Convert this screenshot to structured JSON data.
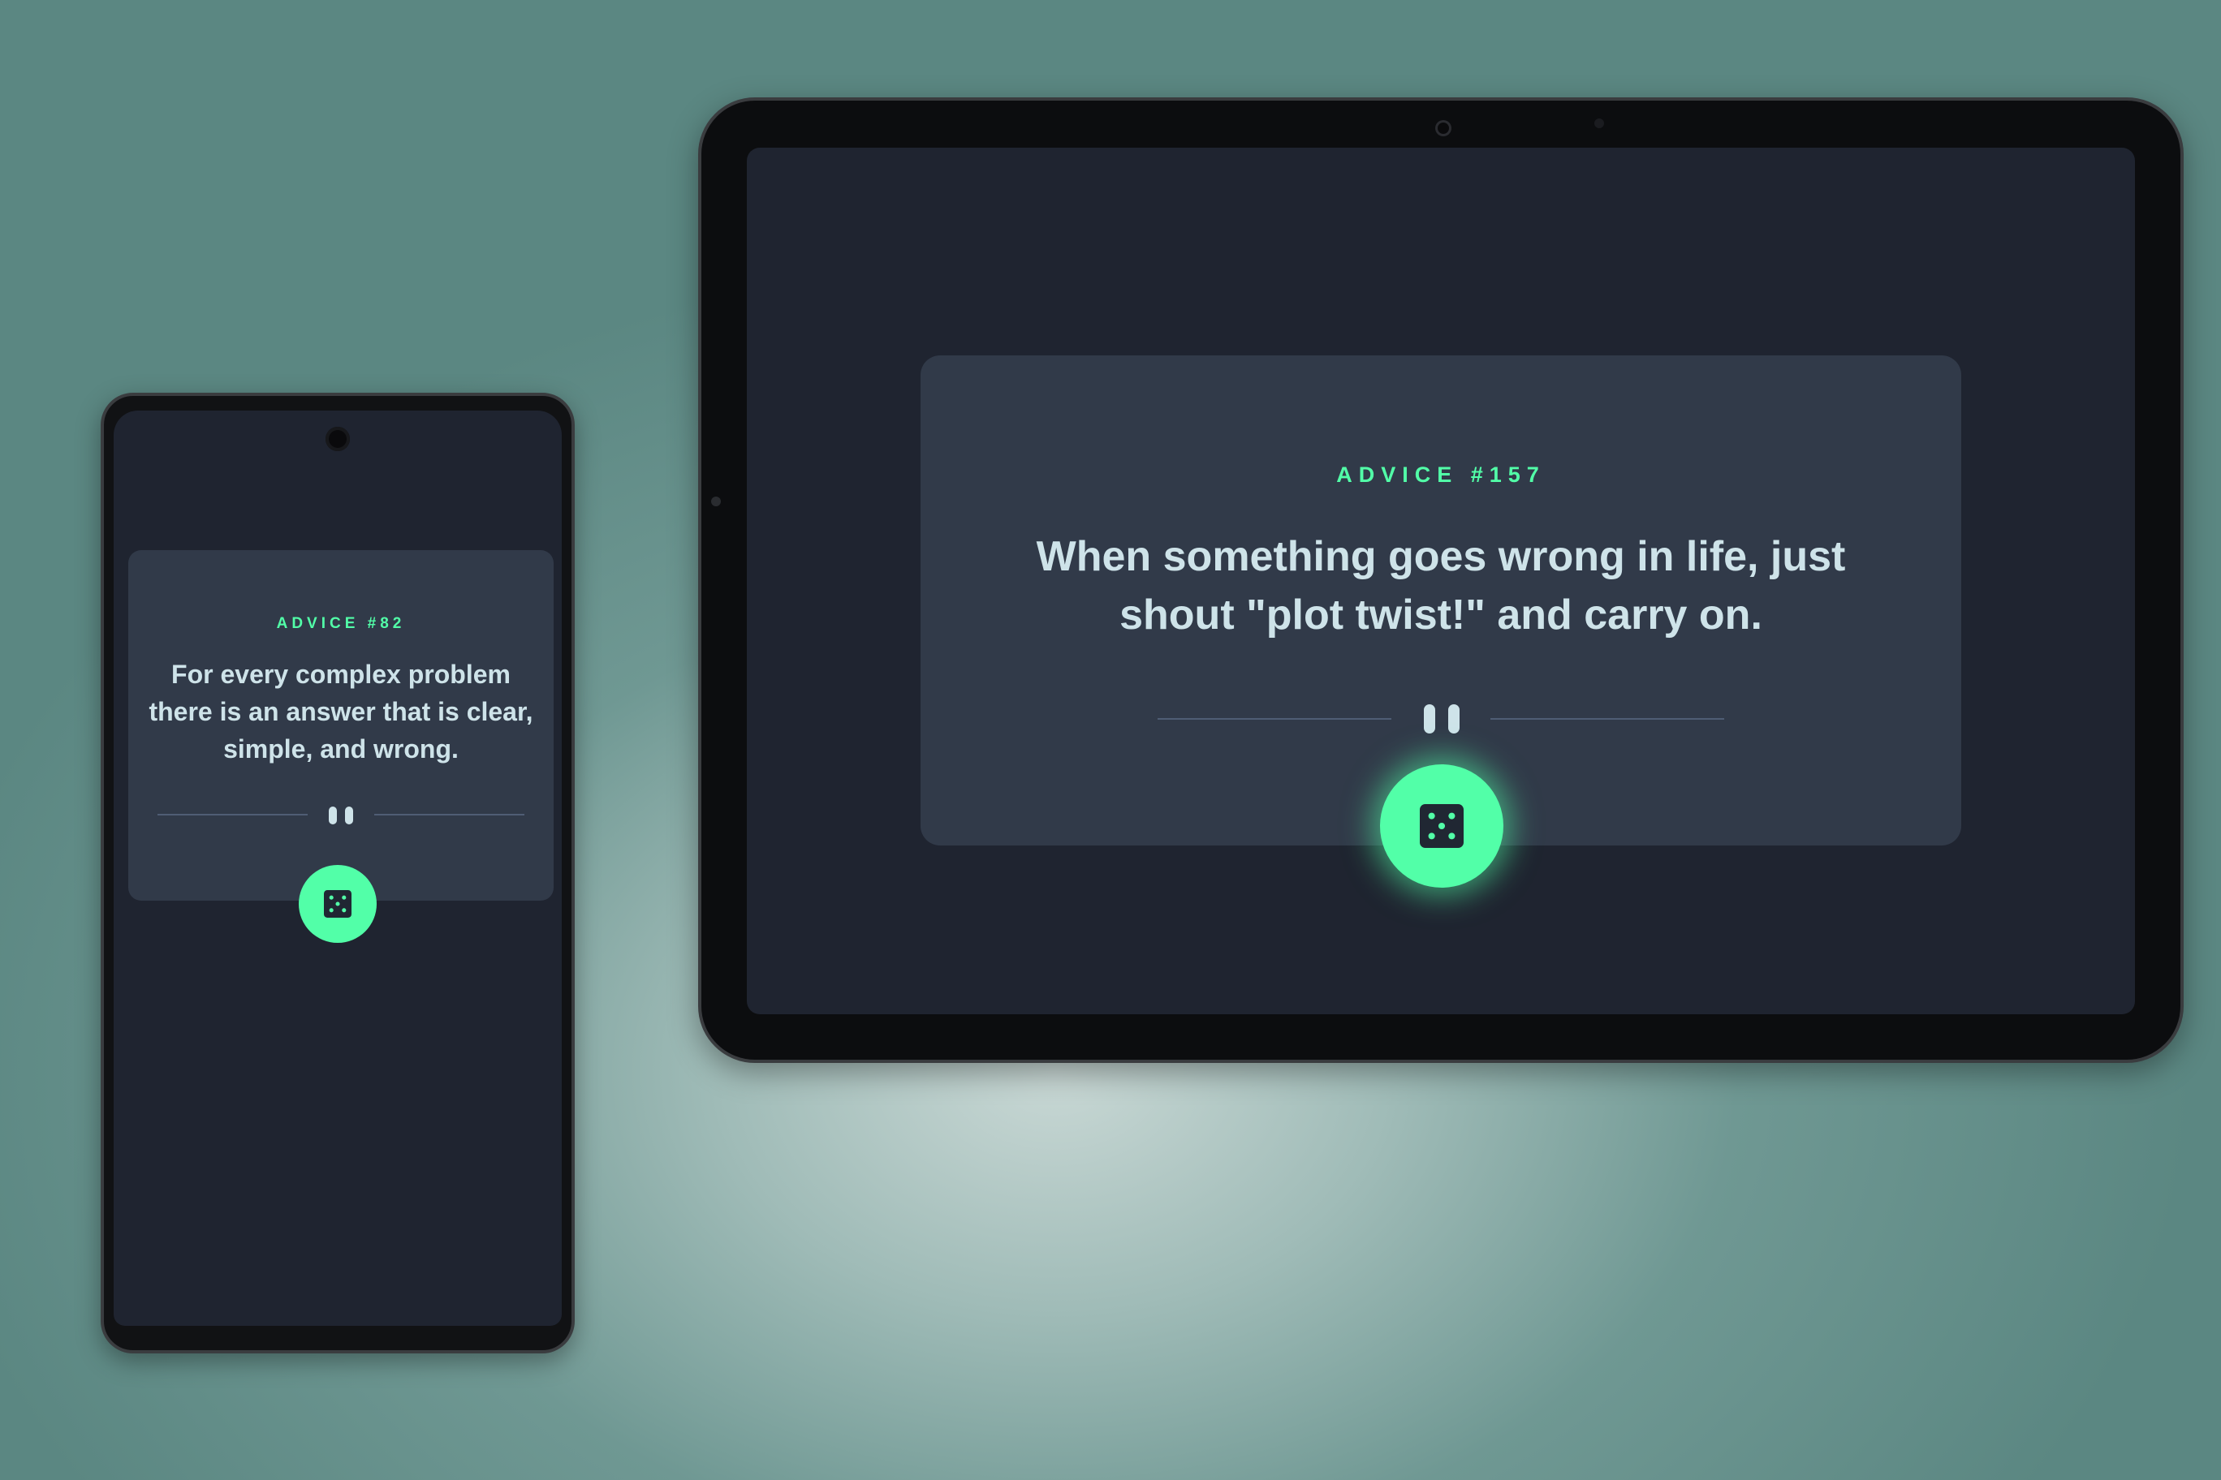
{
  "colors": {
    "background_teal": "#5b8782",
    "screen_bg": "#1f2430",
    "card_bg": "#313a49",
    "accent_green": "#52ffa8",
    "text_light": "#cee3e9",
    "divider": "#4f5d74"
  },
  "phone": {
    "advice_label": "ADVICE #82",
    "advice_text": "For every complex problem there is an answer that is clear, simple, and wrong.",
    "dice_button_icon": "dice-five-icon",
    "divider_icon": "pause-icon"
  },
  "tablet": {
    "advice_label": "ADVICE #157",
    "advice_text": "When something goes wrong in life, just shout \"plot twist!\" and carry on.",
    "dice_button_icon": "dice-five-icon",
    "divider_icon": "pause-icon"
  }
}
